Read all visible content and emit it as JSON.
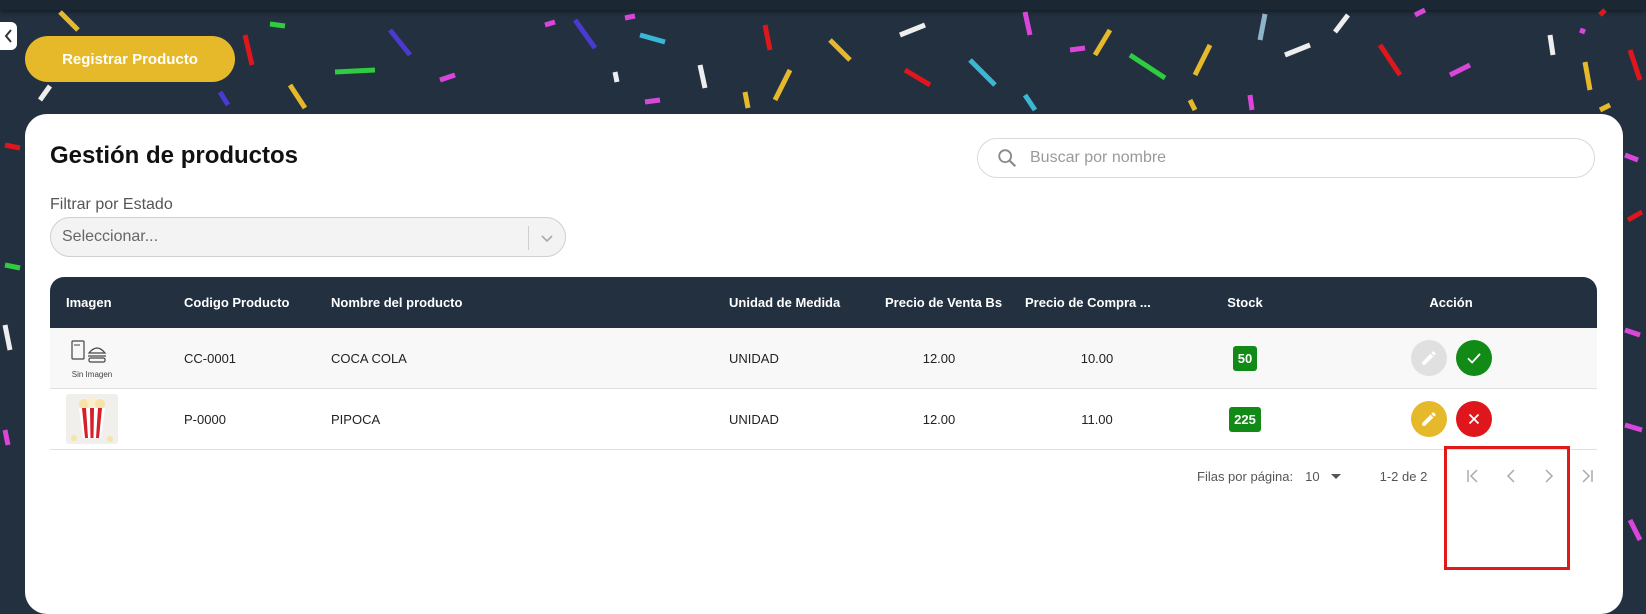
{
  "register_button": "Registrar Producto",
  "page_title": "Gestión de productos",
  "search": {
    "placeholder": "Buscar por nombre"
  },
  "filter": {
    "label": "Filtrar por Estado",
    "placeholder": "Seleccionar..."
  },
  "table": {
    "headers": [
      "Imagen",
      "Codigo Producto",
      "Nombre del producto",
      "Unidad de Medida",
      "Precio de Venta Bs",
      "Precio de Compra ...",
      "Stock",
      "Acción"
    ],
    "rows": [
      {
        "image_label": "Sin Imagen",
        "code": "CC-0001",
        "name": "COCA COLA",
        "unit": "UNIDAD",
        "sale_price": "12.00",
        "purchase_price": "10.00",
        "stock": "50"
      },
      {
        "image_label": "",
        "code": "P-0000",
        "name": "PIPOCA",
        "unit": "UNIDAD",
        "sale_price": "12.00",
        "purchase_price": "11.00",
        "stock": "225"
      }
    ]
  },
  "pagination": {
    "rows_label": "Filas por página:",
    "rows_per_page": "10",
    "range": "1-2 de 2"
  },
  "colors": {
    "accent": "#e6b92b",
    "header": "#223040",
    "success": "#118a16",
    "danger": "#e0161d"
  }
}
